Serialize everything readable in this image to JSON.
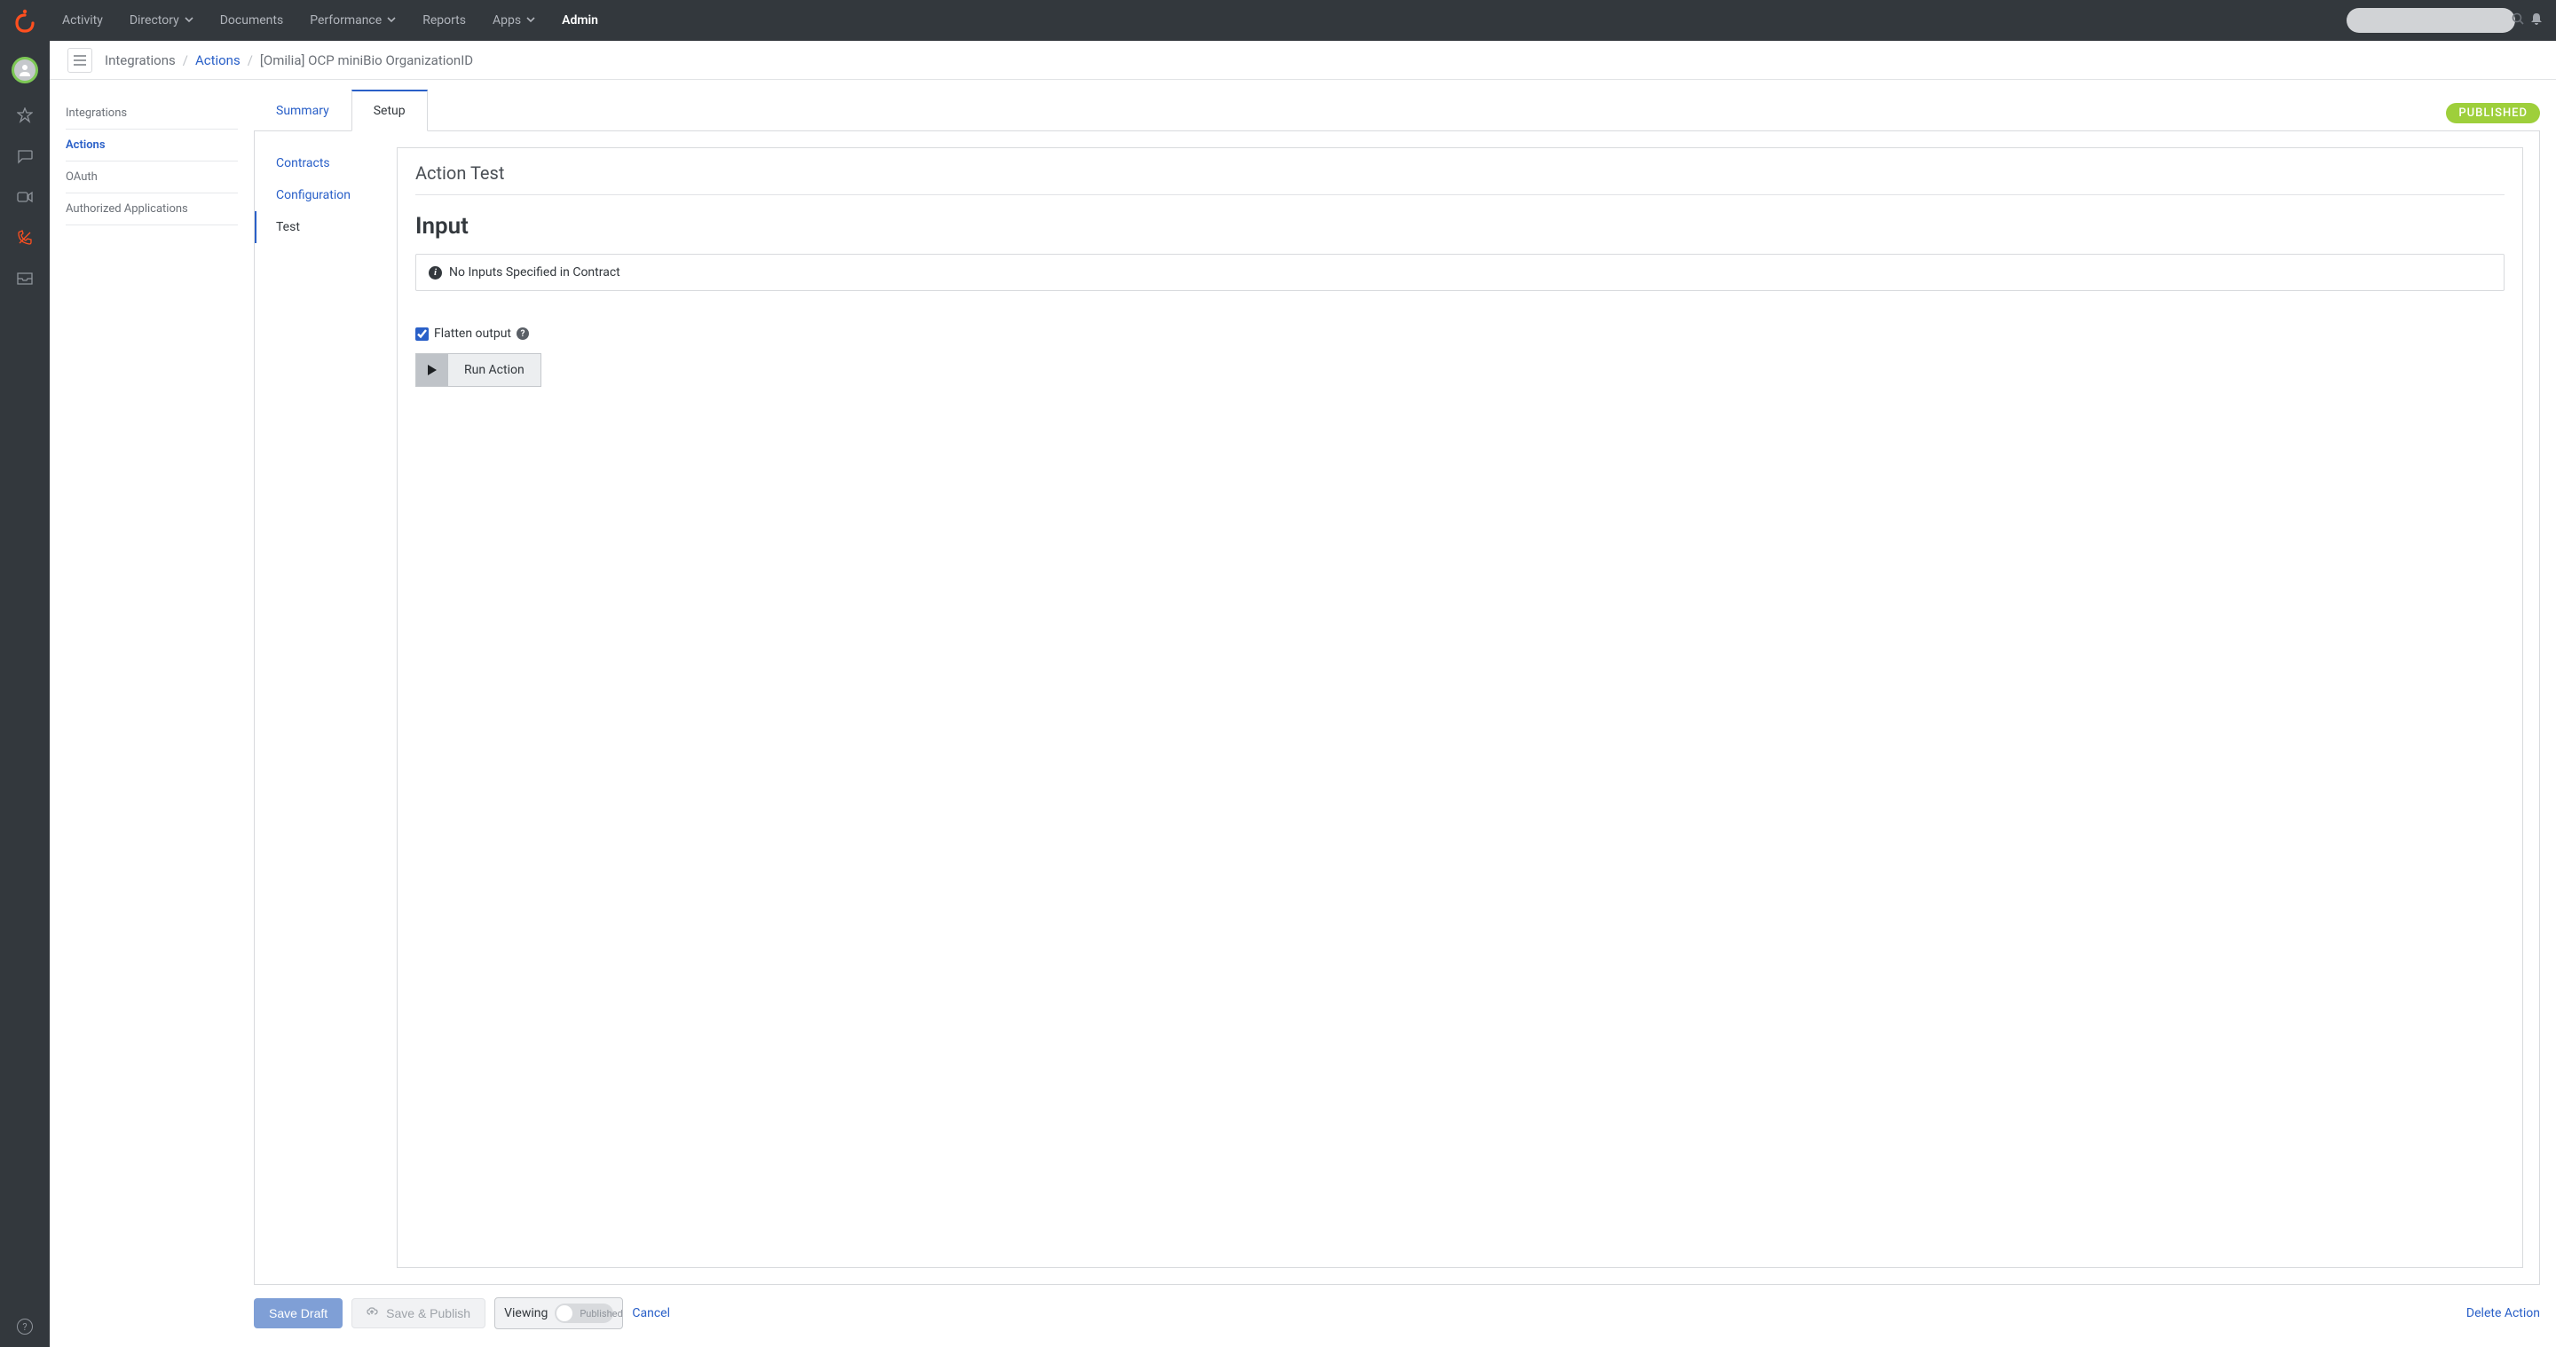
{
  "topnav": {
    "links": [
      {
        "label": "Activity",
        "dropdown": false
      },
      {
        "label": "Directory",
        "dropdown": true
      },
      {
        "label": "Documents",
        "dropdown": false
      },
      {
        "label": "Performance",
        "dropdown": true
      },
      {
        "label": "Reports",
        "dropdown": false
      },
      {
        "label": "Apps",
        "dropdown": true
      },
      {
        "label": "Admin",
        "dropdown": false,
        "active": true
      }
    ],
    "search_placeholder": ""
  },
  "breadcrumb": {
    "root": "Integrations",
    "link": "Actions",
    "current": "[Omilia] OCP miniBio OrganizationID"
  },
  "secnav": {
    "items": [
      "Integrations",
      "Actions",
      "OAuth",
      "Authorized Applications"
    ],
    "active": "Actions"
  },
  "tabs": {
    "summary": "Summary",
    "setup": "Setup",
    "status": "PUBLISHED"
  },
  "subnav": {
    "contracts": "Contracts",
    "configuration": "Configuration",
    "test": "Test"
  },
  "panel": {
    "title": "Action Test",
    "section": "Input",
    "no_inputs": "No Inputs Specified in Contract",
    "flatten_label": "Flatten output",
    "run_label": "Run Action"
  },
  "footer": {
    "save_draft": "Save Draft",
    "save_publish": "Save & Publish",
    "viewing": "Viewing",
    "published": "Published",
    "cancel": "Cancel",
    "delete": "Delete Action"
  }
}
